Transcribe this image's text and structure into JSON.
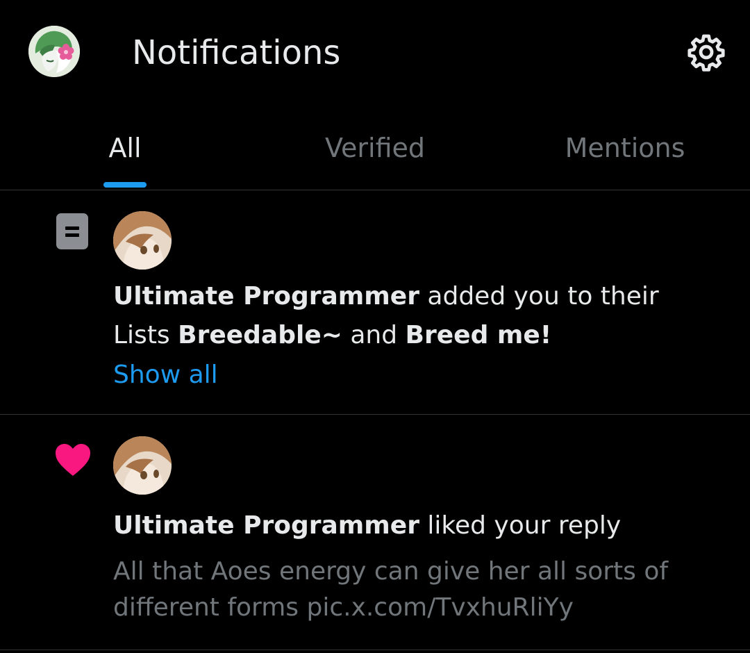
{
  "header": {
    "title": "Notifications",
    "avatar_icon": "profile-avatar",
    "settings_icon": "gear-icon"
  },
  "tabs": [
    {
      "label": "All",
      "active": true
    },
    {
      "label": "Verified",
      "active": false
    },
    {
      "label": "Mentions",
      "active": false
    }
  ],
  "notifications": [
    {
      "type": "list-add",
      "icon": "list-icon",
      "user": "Ultimate Programmer",
      "action_pre": " added you to their Lists ",
      "list_1": "Breedable~",
      "conjunction": " and ",
      "list_2": "Breed me!",
      "link": "Show all"
    },
    {
      "type": "like",
      "icon": "heart-icon",
      "user": "Ultimate Programmer",
      "action": " liked your reply",
      "preview": "All that Aoes energy can give her all sorts of different forms pic.x.com/TvxhuRliYy"
    }
  ],
  "colors": {
    "background": "#000000",
    "text_primary": "#e7e9ea",
    "text_secondary": "#71767b",
    "accent": "#1d9bf0",
    "like": "#f91880",
    "divider": "#2f3336"
  }
}
